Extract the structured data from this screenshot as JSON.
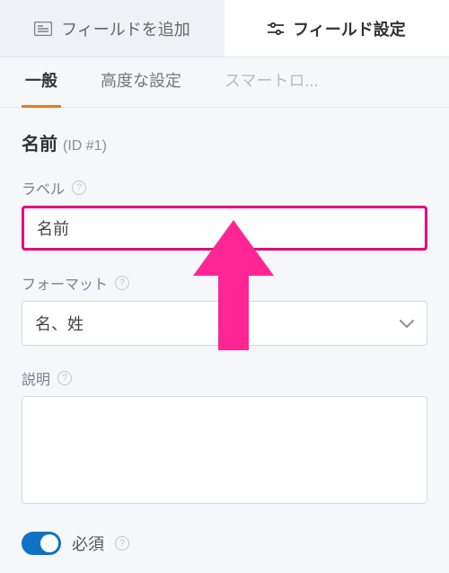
{
  "header": {
    "add_field_label": "フィールドを追加",
    "field_settings_label": "フィールド設定"
  },
  "subtabs": {
    "general": "一般",
    "advanced": "高度な設定",
    "smart": "スマートロ..."
  },
  "section": {
    "title": "名前",
    "id_text": "(ID #1)"
  },
  "label_field": {
    "label": "ラベル",
    "value": "名前"
  },
  "format_field": {
    "label": "フォーマット",
    "value": "名、姓"
  },
  "description_field": {
    "label": "説明",
    "value": ""
  },
  "required_toggle": {
    "label": "必須",
    "on": true
  }
}
